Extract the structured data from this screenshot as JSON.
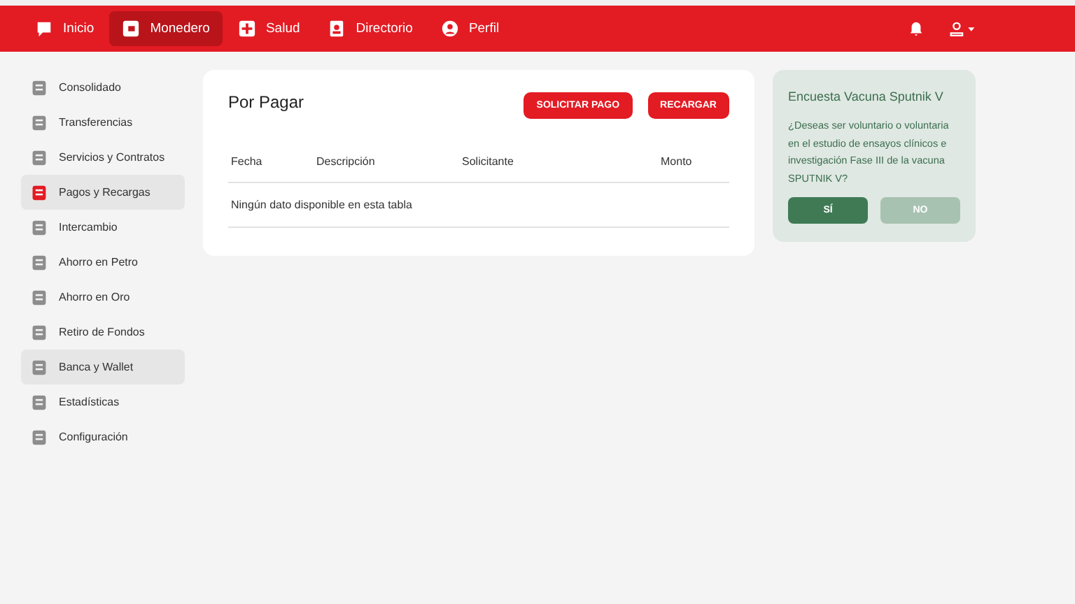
{
  "nav": {
    "items": [
      {
        "label": "Inicio",
        "selected": false
      },
      {
        "label": "Monedero",
        "selected": true
      },
      {
        "label": "Salud",
        "selected": false
      },
      {
        "label": "Directorio",
        "selected": false
      },
      {
        "label": "Perfil",
        "selected": false
      }
    ]
  },
  "sidebar": {
    "items": [
      {
        "label": "Consolidado",
        "selected": false,
        "hovered": false
      },
      {
        "label": "Transferencias",
        "selected": false,
        "hovered": false
      },
      {
        "label": "Servicios y Contratos",
        "selected": false,
        "hovered": false
      },
      {
        "label": "Pagos y Recargas",
        "selected": true,
        "hovered": false
      },
      {
        "label": "Intercambio",
        "selected": false,
        "hovered": false
      },
      {
        "label": "Ahorro en Petro",
        "selected": false,
        "hovered": false
      },
      {
        "label": "Ahorro en Oro",
        "selected": false,
        "hovered": false
      },
      {
        "label": "Retiro de Fondos",
        "selected": false,
        "hovered": false
      },
      {
        "label": "Banca y Wallet",
        "selected": false,
        "hovered": true
      },
      {
        "label": "Estadísticas",
        "selected": false,
        "hovered": false
      },
      {
        "label": "Configuración",
        "selected": false,
        "hovered": false
      }
    ]
  },
  "panel": {
    "title": "Por Pagar",
    "buttons": [
      "SOLICITAR PAGO",
      "RECARGAR"
    ],
    "table": {
      "columns": [
        "Fecha",
        "Descripción",
        "Solicitante",
        "Monto"
      ],
      "empty_message": "Ningún dato disponible en esta tabla"
    }
  },
  "survey": {
    "title": "Encuesta Vacuna Sputnik V",
    "question": "¿Deseas ser voluntario o voluntaria en el estudio de ensayos clínicos e investigación Fase III de la vacuna SPUTNIK V?",
    "buttons": [
      {
        "label": "SÍ",
        "kind": "primary"
      },
      {
        "label": "NO",
        "kind": "secondary"
      }
    ]
  }
}
